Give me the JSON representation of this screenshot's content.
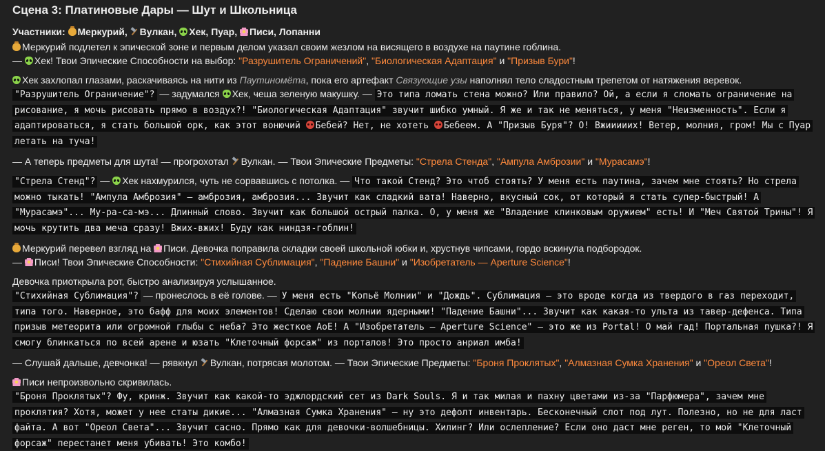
{
  "title": "Сцена 3: Платиновые Дары — Шут и Школьница",
  "cast": {
    "label": "Участники:",
    "merc": "Меркурий,",
    "vulkan": "Вулкан,",
    "hek": "Хек, Пуар,",
    "pisi": "Писи, Лопанни"
  },
  "p1": {
    "a": "Меркурий подлетел к эпической зоне и первым делом указал своим жезлом на висящего в воздухе на паутине гоблина.",
    "b1": "—",
    "b2": "Хек! Твои Эпические Способности на выбор:",
    "h1": "\"Разрушитель Ограничений\"",
    "s1": ",",
    "h2": "\"Биологическая Адаптация\"",
    "s2": "и",
    "h3": "\"Призыв Бури\"",
    "end": "!"
  },
  "p2": {
    "a": "Хек захлопал глазами, раскачиваясь на нити из",
    "it1": "Паутиномёта",
    "b": ", пока его артефакт",
    "it2": "Связующие узы",
    "c": "наполнял тело сладостным трепетом от натяжения веревок.",
    "code1": "\"Разрушитель Ограничение\"?",
    "mid1": "— задумался",
    "mid2": "Хек, чеша зеленую макушку. —",
    "code2": "Это типа ломать стена можно? Или правило? Ой, а если я сломать ограничение на рисование, я мочь рисовать прямо в воздух?! \"Биологическая Адаптация\" звучит шибко умный. Я же и так не меняться, у меня \"Неизменность\". Если я адаптироваться, я стать большой орк, как этот вонючий",
    "code3": "Бебей? Нет, не хотеть",
    "code4": "Бебеем. А \"Призыв Буря\"? О! Вжииииих! Ветер, молния, гром! Мы с Пуар летать на туча!"
  },
  "p3": {
    "a": "— А теперь предметы для шута! — прогрохотал",
    "b": "Вулкан. — Твои Эпические Предметы:",
    "h1": "\"Стрела Стенда\"",
    "s1": ",",
    "h2": "\"Ампула Амброзии\"",
    "s2": "и",
    "h3": "\"Мурасамэ\"",
    "end": "!"
  },
  "p4": {
    "code1": "\"Стрела Стенд\"?",
    "mid1": "—",
    "mid2": "Хек нахмурился, чуть не сорвавшись с потолка. —",
    "code2": "Что такой Стенд? Это чтоб стоять? У меня есть паутина, зачем мне стоять? Но стрела можно тыкать! \"Ампула Амброзия\" — амброзия, амброзия... Звучит как сладкий вата! Наверно, вкусный сок, от который я стать супер-быстрый! А \"Мурасамэ\"... Му-ра-са-мэ... Длинный слово. Звучит как большой острый палка. О, у меня же \"Владение клинковым оружием\" есть! И \"Меч Святой Трины\"! Я мочь крутить два меча сразу! Вжих-вжих! Буду как ниндзя-гоблин!"
  },
  "p5": {
    "a": "Меркурий перевел взгляд на",
    "b": "Писи. Девочка поправила складки своей школьной юбки и, хрустнув чипсами, гордо вскинула подбородок.",
    "c1": "—",
    "c2": "Писи! Твои Эпические Способности:",
    "h1": "\"Стихийная Сублимация\"",
    "s1": ",",
    "h2": "\"Падение Башни\"",
    "s2": "и",
    "h3": "\"Изобретатель — Aperture Science\"",
    "end": "!"
  },
  "p6": {
    "a": "Девочка приоткрыла рот, быстро анализируя услышанное.",
    "code1": "\"Стихийная Сублимация\"?",
    "mid": "— пронеслось в её голове. —",
    "code2": "У меня есть \"Копьё Молнии\" и \"Дождь\". Сублимация — это вроде когда из твердого в газ переходит, типа того. Наверное, это бафф для моих элементов! Сделаю свои молнии ядерными! \"Падение Башни\"... Звучит как какая-то ульта из тавер-дефенса. Типа призыв метеорита или огромной глыбы с неба? Это жесткое АоЕ! А \"Изобретатель — Aperture Science\" — это же из Portal! О май гад! Портальная пушка?! Я смогу блинкаться по всей арене и юзать \"Клеточный форсаж\" из порталов! Это просто анриал имба!"
  },
  "p7": {
    "a": "— Слушай дальше, девчонка! — рявкнул",
    "b": "Вулкан, потрясая молотом. — Твои Эпические Предметы:",
    "h1": "\"Броня Проклятых\"",
    "s1": ",",
    "h2": "\"Алмазная Сумка Хранения\"",
    "s2": "и",
    "h3": "\"Ореол Света\"",
    "end": "!"
  },
  "p8": {
    "a": "Писи непроизвольно скривилась.",
    "code": "\"Броня Проклятых\"? Фу, кринж. Звучит как какой-то эджлордский сет из Dark Souls. Я и так милая и пахну цветами из-за \"Парфюмера\", зачем мне проклятия? Хотя, может у нее статы дикие... \"Алмазная Сумка Хранения\" — ну это дефолт инвентарь. Бесконечный слот под лут. Полезно, но не для ласт файта. А вот \"Ореол Света\"... Звучит сасно. Прямо как для девочки-волшебницы. Хилинг? Или ослепление? Если оно даст мне реген, то мой \"Клеточный форсаж\" перестанет меня убивать! Это комбо!"
  },
  "icons": [
    "money-bag-icon",
    "hammer-icon",
    "alien-icon",
    "blossom-icon",
    "devil-icon"
  ],
  "colors": {
    "background": "#212121",
    "text": "#ececec",
    "highlight": "#ff8a3d",
    "code_bg": "#0d0d0d"
  }
}
